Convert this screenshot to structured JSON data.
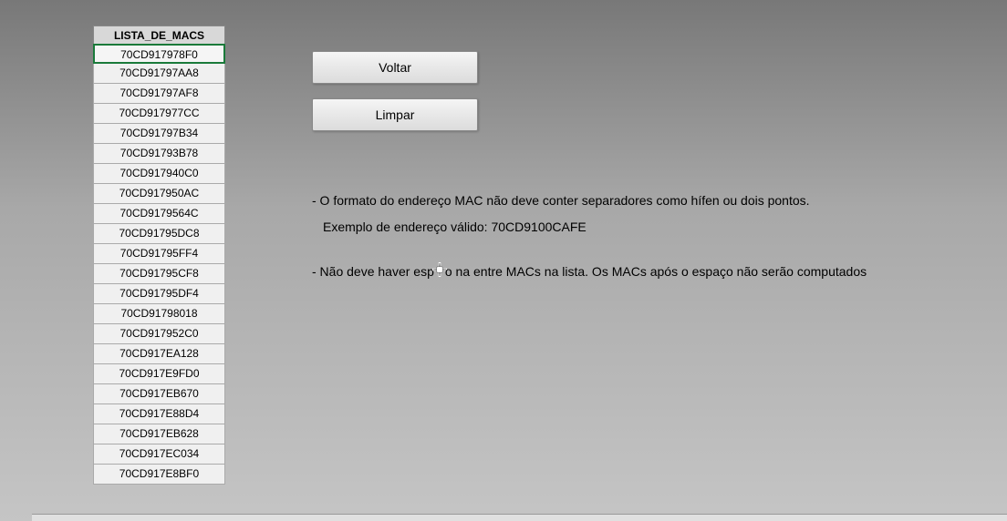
{
  "list": {
    "header": "LISTA_DE_MACS",
    "items": [
      "70CD917978F0",
      "70CD91797AA8",
      "70CD91797AF8",
      "70CD917977CC",
      "70CD91797B34",
      "70CD91793B78",
      "70CD917940C0",
      "70CD917950AC",
      "70CD9179564C",
      "70CD91795DC8",
      "70CD91795FF4",
      "70CD91795CF8",
      "70CD91795DF4",
      "70CD91798018",
      "70CD917952C0",
      "70CD917EA128",
      "70CD917E9FD0",
      "70CD917EB670",
      "70CD917E88D4",
      "70CD917EB628",
      "70CD917EC034",
      "70CD917E8BF0"
    ],
    "selected_index": 0
  },
  "buttons": {
    "back_label": "Voltar",
    "clear_label": "Limpar"
  },
  "info": {
    "line1": "- O formato do endereço MAC não deve conter separadores como hífen ou dois pontos.",
    "line2": "Exemplo de endereço válido: 70CD9100CAFE",
    "line3_a": "- Não deve haver esp",
    "line3_b": "o na entre MACs na lista. Os MACs após o espaço não serão computados"
  }
}
